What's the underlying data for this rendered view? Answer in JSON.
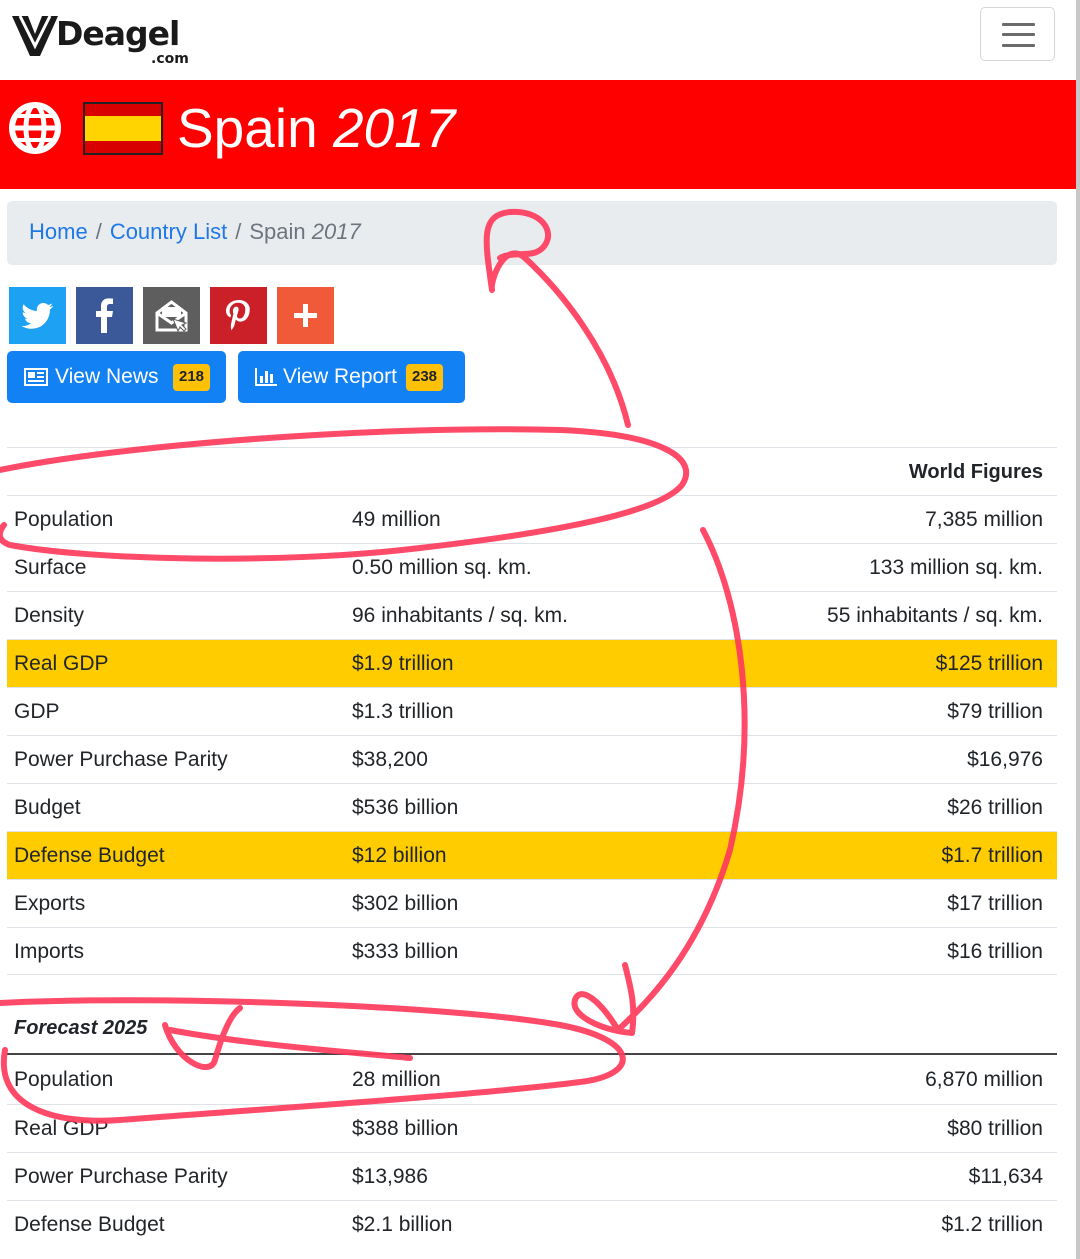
{
  "site": {
    "logo_text": "Deagel",
    "logo_suffix": ".com",
    "logo_icon": "deagel-fighter-jet-icon",
    "menu_icon": "hamburger-menu-icon"
  },
  "header": {
    "globe_icon": "globe-icon",
    "flag_icon": "spain-flag-icon",
    "country": "Spain",
    "year": "2017",
    "background_color": "#ff0000"
  },
  "breadcrumb": {
    "home": "Home",
    "country_list": "Country List",
    "current_country": "Spain",
    "current_year": "2017",
    "separator": "/"
  },
  "share": [
    {
      "name": "twitter",
      "icon": "twitter-icon",
      "color": "#1da1f2"
    },
    {
      "name": "facebook",
      "icon": "facebook-icon",
      "color": "#3b5998"
    },
    {
      "name": "email",
      "icon": "email-icon",
      "color": "#5e5e5e"
    },
    {
      "name": "pinterest",
      "icon": "pinterest-icon",
      "color": "#cb2027"
    },
    {
      "name": "more",
      "icon": "plus-icon",
      "color": "#f05a38"
    }
  ],
  "actions": {
    "news_label": "View News",
    "news_count": "218",
    "report_label": "View Report",
    "report_count": "238"
  },
  "figures": {
    "column_world": "World Figures",
    "highlight_color": "#ffcc00",
    "rows": [
      {
        "label": "Population",
        "country": "49 million",
        "world": "7,385 million",
        "highlight": false
      },
      {
        "label": "Surface",
        "country": "0.50 million sq. km.",
        "world": "133 million sq. km.",
        "highlight": false
      },
      {
        "label": "Density",
        "country": "96 inhabitants / sq. km.",
        "world": "55 inhabitants / sq. km.",
        "highlight": false
      },
      {
        "label": "Real GDP",
        "country": "$1.9 trillion",
        "world": "$125 trillion",
        "highlight": true
      },
      {
        "label": "GDP",
        "country": "$1.3 trillion",
        "world": "$79 trillion",
        "highlight": false
      },
      {
        "label": "Power Purchase Parity",
        "country": "$38,200",
        "world": "$16,976",
        "highlight": false
      },
      {
        "label": "Budget",
        "country": "$536 billion",
        "world": "$26 trillion",
        "highlight": false
      },
      {
        "label": "Defense Budget",
        "country": "$12 billion",
        "world": "$1.7 trillion",
        "highlight": true
      },
      {
        "label": "Exports",
        "country": "$302 billion",
        "world": "$17 trillion",
        "highlight": false
      },
      {
        "label": "Imports",
        "country": "$333 billion",
        "world": "$16 trillion",
        "highlight": false
      }
    ]
  },
  "forecast": {
    "title": "Forecast 2025",
    "rows": [
      {
        "label": "Population",
        "country": "28 million",
        "world": "6,870 million"
      },
      {
        "label": "Real GDP",
        "country": "$388 billion",
        "world": "$80 trillion"
      },
      {
        "label": "Power Purchase Parity",
        "country": "$13,986",
        "world": "$11,634"
      },
      {
        "label": "Defense Budget",
        "country": "$2.1 billion",
        "world": "$1.2 trillion"
      }
    ]
  },
  "annotation": {
    "color": "#ff3b5c",
    "description_shapes": [
      "circle-header-row",
      "arrow-to-breadcrumb",
      "circle-forecast-population",
      "arrow-to-forecast"
    ]
  }
}
